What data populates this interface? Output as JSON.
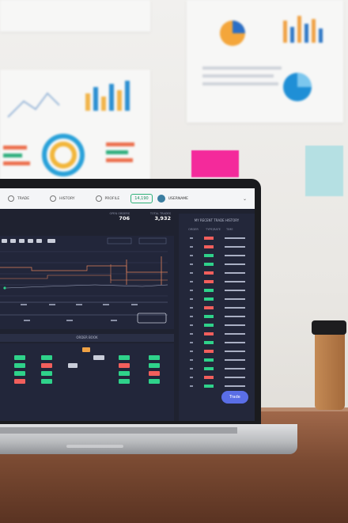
{
  "app": {
    "nav": [
      {
        "label": "TRADE",
        "icon": "trade-icon"
      },
      {
        "label": "HISTORY",
        "icon": "history-icon"
      },
      {
        "label": "PROFILE",
        "icon": "profile-icon"
      }
    ],
    "balance": "14,190",
    "username": "USERNAME",
    "stats": [
      {
        "label": "OPEN ORDERS",
        "value": "706"
      },
      {
        "label": "TOTAL TRADES",
        "value": "3,932"
      }
    ],
    "history_title": "MY RECENT TRADE HISTORY",
    "history_headers": [
      "ORDER",
      "TYPE/RATE",
      "TIME"
    ],
    "order_book_title": "ORDER BOOK",
    "trade_button": "Trade"
  },
  "colors": {
    "accent": "#5a6ee6",
    "buy": "#2fd28a",
    "sell": "#f25f5c",
    "screen_bg": "#1f2230",
    "sticky_note": "#f42a9b",
    "sticky_note_blue": "#b5e0e3"
  }
}
